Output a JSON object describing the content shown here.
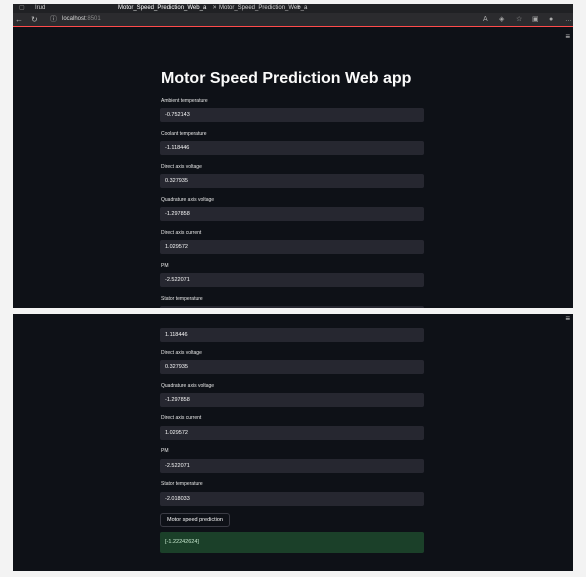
{
  "browser": {
    "tabs": [
      {
        "title": "Irud"
      },
      {
        "title": "Motor_Speed_Prediction_Web_a"
      },
      {
        "title": "Motor_Speed_Prediction_Web_a"
      }
    ],
    "new_tab": "+",
    "url_host": "localhost",
    "url_port": ":8501",
    "nav": {
      "back": "←",
      "reload": "↻",
      "info": "ⓘ"
    }
  },
  "app": {
    "title": "Motor Speed Prediction Web app",
    "menu_icon": "≡",
    "fields_top": [
      {
        "label": "Ambient temperature",
        "value": "-0.752143"
      },
      {
        "label": "Coolant temperature",
        "value": "-1.118446"
      },
      {
        "label": "Direct axis voltage",
        "value": "0.327935"
      },
      {
        "label": "Quadrature axis voltage",
        "value": "-1.297858"
      },
      {
        "label": "Direct axis current",
        "value": "1.029572"
      },
      {
        "label": "PM",
        "value": "-2.522071"
      },
      {
        "label": "Stator temperature",
        "value": ""
      }
    ],
    "fields_bottom": [
      {
        "label": "",
        "value": "1.118446"
      },
      {
        "label": "Direct axis voltage",
        "value": "0.327935"
      },
      {
        "label": "Quadrature axis voltage",
        "value": "-1.297858"
      },
      {
        "label": "Direct axis current",
        "value": "1.029572"
      },
      {
        "label": "PM",
        "value": "-2.522071"
      },
      {
        "label": "Stator temperature",
        "value": "-2.018033"
      }
    ],
    "predict_button": "Motor speed prediction",
    "result": "[-1.22242624]"
  }
}
